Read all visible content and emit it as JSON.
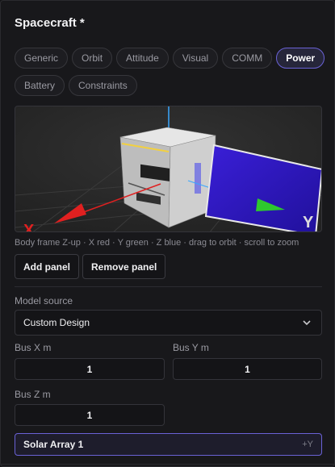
{
  "title": "Spacecraft *",
  "tabs_row1": [
    "Generic",
    "Orbit",
    "Attitude",
    "Visual",
    "COMM",
    "Power"
  ],
  "tabs_row2": [
    "Battery",
    "Constraints"
  ],
  "active_tab": "Power",
  "viewport": {
    "axis_label_x": "X",
    "axis_label_y": "Y",
    "colors": {
      "x_axis": "#e02020",
      "y_axis": "#2ec82e",
      "z_axis": "#3aa8ff",
      "panel": "#2a0fb8",
      "bus": "#cfcfcf"
    }
  },
  "hint": "Body frame Z-up · X red · Y green · Z blue · drag to orbit · scroll to zoom",
  "buttons": {
    "add_panel": "Add panel",
    "remove_panel": "Remove panel"
  },
  "model_source": {
    "label": "Model source",
    "value": "Custom Design"
  },
  "bus_x": {
    "label": "Bus X m",
    "value": "1"
  },
  "bus_y": {
    "label": "Bus Y m",
    "value": "1"
  },
  "bus_z": {
    "label": "Bus Z m",
    "value": "1"
  },
  "panel_item": {
    "name": "Solar Array 1",
    "face": "+Y"
  }
}
